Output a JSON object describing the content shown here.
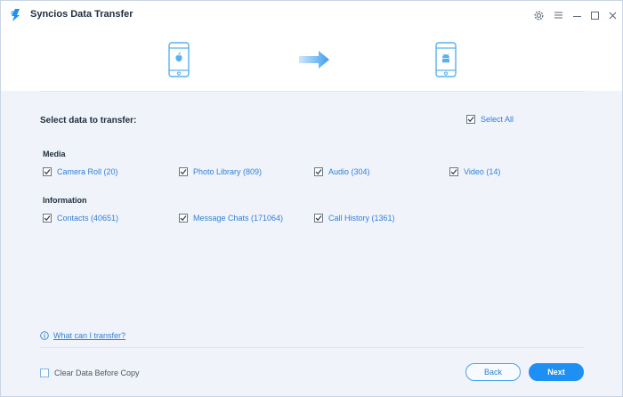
{
  "window": {
    "title": "Syncios Data Transfer",
    "controls": [
      "gear-icon",
      "menu-icon",
      "minimize-icon",
      "maximize-icon",
      "close-icon"
    ]
  },
  "devices": {
    "source": "iphone-icon",
    "direction": "arrow-right-icon",
    "target": "android-phone-icon"
  },
  "selection": {
    "heading": "Select data to transfer:",
    "select_all_label": "Select All",
    "select_all_checked": true
  },
  "groups": [
    {
      "title": "Media",
      "items": [
        {
          "label": "Camera Roll (20)",
          "checked": true
        },
        {
          "label": "Photo Library (809)",
          "checked": true
        },
        {
          "label": "Audio (304)",
          "checked": true
        },
        {
          "label": "Video (14)",
          "checked": true
        }
      ]
    },
    {
      "title": "Information",
      "items": [
        {
          "label": "Contacts (40651)",
          "checked": true
        },
        {
          "label": "Message Chats (171064)",
          "checked": true
        },
        {
          "label": "Call History (1361)",
          "checked": true
        }
      ]
    }
  ],
  "help": {
    "link_text": "What can I transfer?"
  },
  "footer": {
    "clear_data_label": "Clear Data Before Copy",
    "clear_data_checked": false,
    "back_label": "Back",
    "next_label": "Next"
  },
  "colors": {
    "accent": "#1e8ff5",
    "link": "#2f7fd8",
    "background": "#f0f4fa"
  }
}
